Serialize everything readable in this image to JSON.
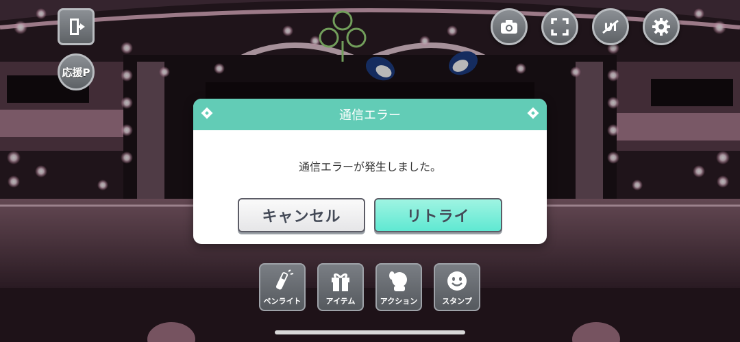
{
  "top_left": {
    "exit_icon": "exit-door-icon",
    "support_label": "応援P"
  },
  "top_right": [
    {
      "name": "camera-button",
      "icon": "camera-icon"
    },
    {
      "name": "fullscreen-button",
      "icon": "fullscreen-icon"
    },
    {
      "name": "hide-ui-button",
      "icon": "hide-ui-icon"
    },
    {
      "name": "settings-button",
      "icon": "gear-icon"
    }
  ],
  "dialog": {
    "title": "通信エラー",
    "message": "通信エラーが発生しました。",
    "cancel_label": "キャンセル",
    "retry_label": "リトライ"
  },
  "toolbar": {
    "penlight_label": "ペンライト",
    "item_label": "アイテム",
    "action_label": "アクション",
    "stamp_label": "スタンプ"
  },
  "colors": {
    "dialog_header": "#62ccb6",
    "retry_button": "#5fe8d2",
    "stage_pink": "#b98a9c"
  }
}
